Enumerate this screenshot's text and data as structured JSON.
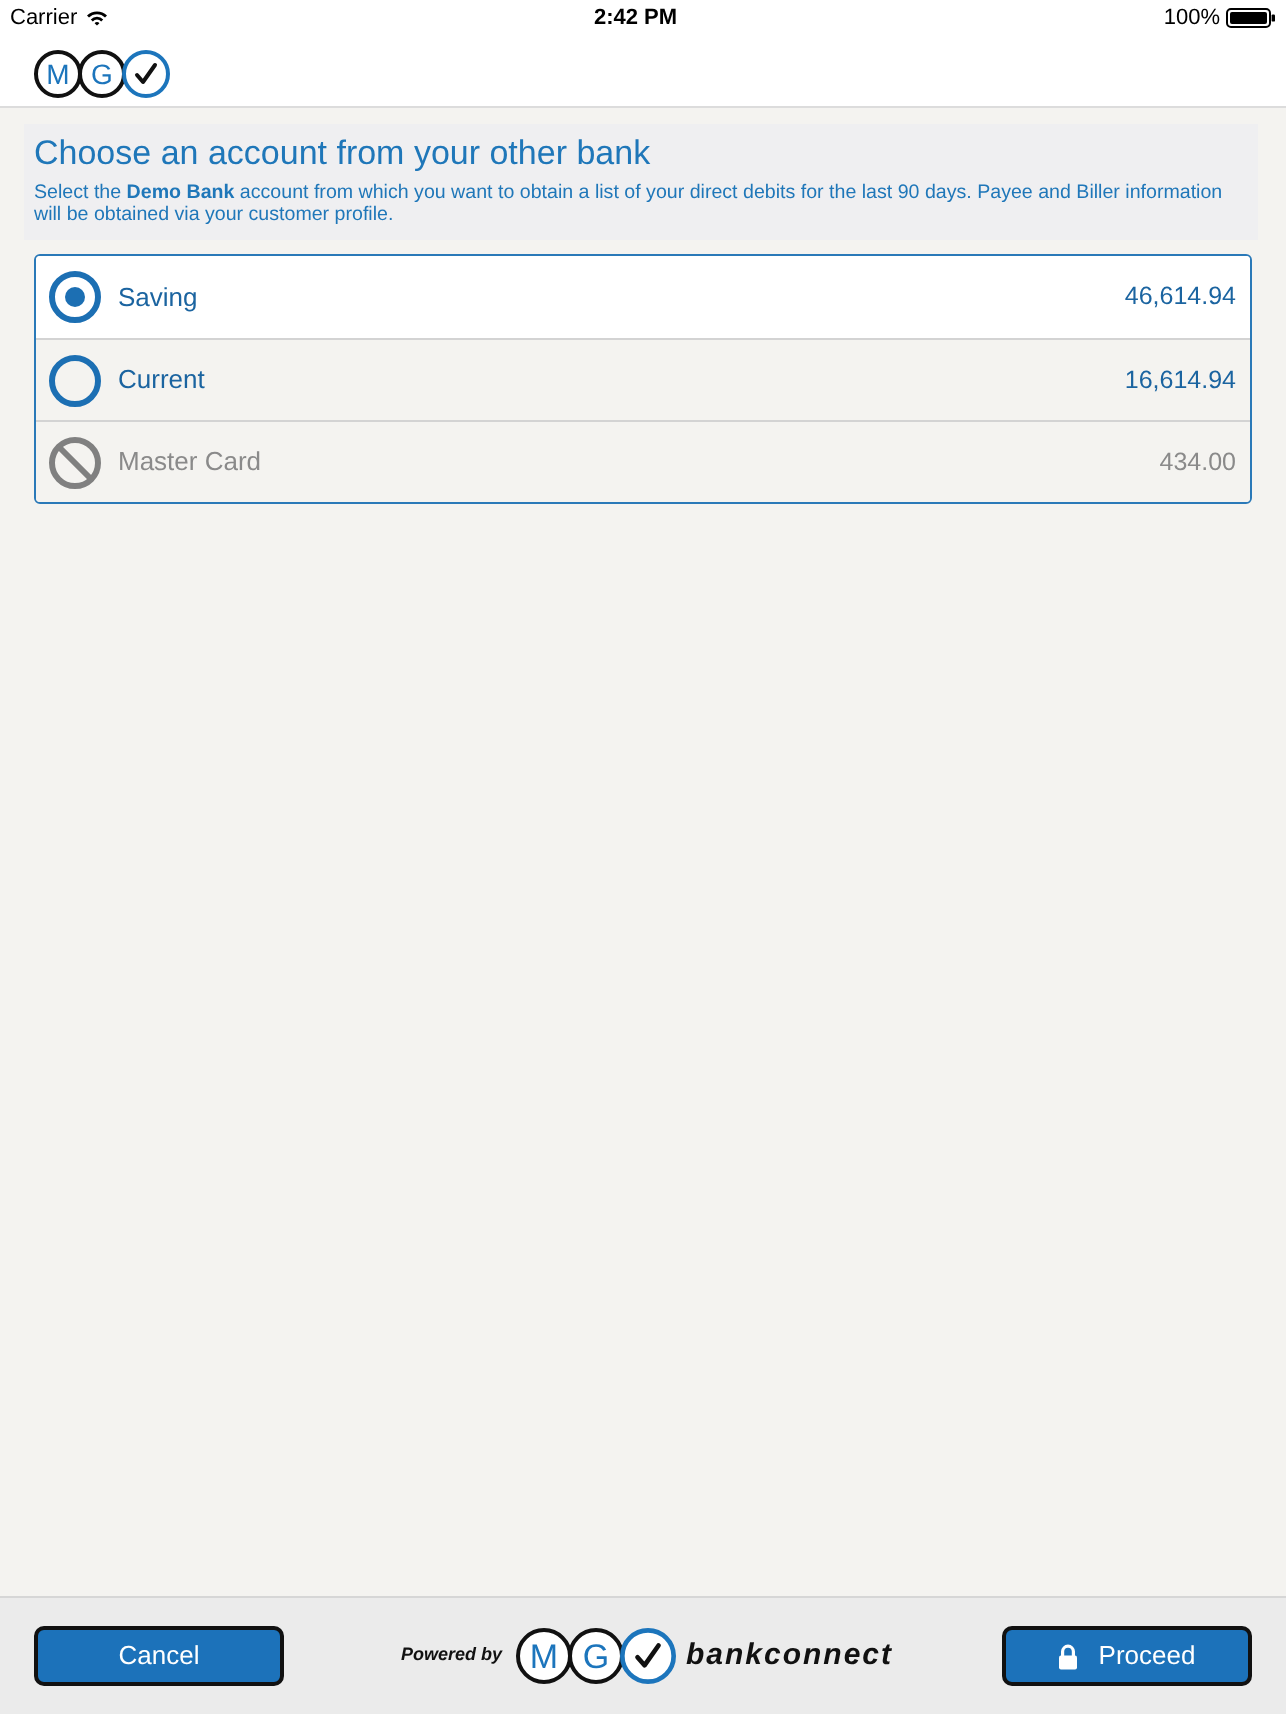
{
  "status_bar": {
    "carrier": "Carrier",
    "time": "2:42 PM",
    "battery": "100%"
  },
  "header": {
    "logo": [
      "M",
      "G"
    ]
  },
  "intro": {
    "title": "Choose an account from your other bank",
    "description": "Select the **Demo Bank** account from which you want to obtain a list of your direct debits for the last 90 days. Payee and Biller information will be obtained via your customer profile."
  },
  "accounts": [
    {
      "name": "Saving",
      "amount": "46,614.94",
      "selected": true,
      "disabled": false
    },
    {
      "name": "Current",
      "amount": "16,614.94",
      "selected": false,
      "disabled": false
    },
    {
      "name": "Master Card",
      "amount": "434.00",
      "selected": false,
      "disabled": true
    }
  ],
  "footer": {
    "cancel": {
      "label": "Cancel"
    },
    "powered_by": "Powered by",
    "logo": [
      "M",
      "G"
    ],
    "brand": "bankconnect",
    "proceed": {
      "label": "Proceed"
    }
  }
}
